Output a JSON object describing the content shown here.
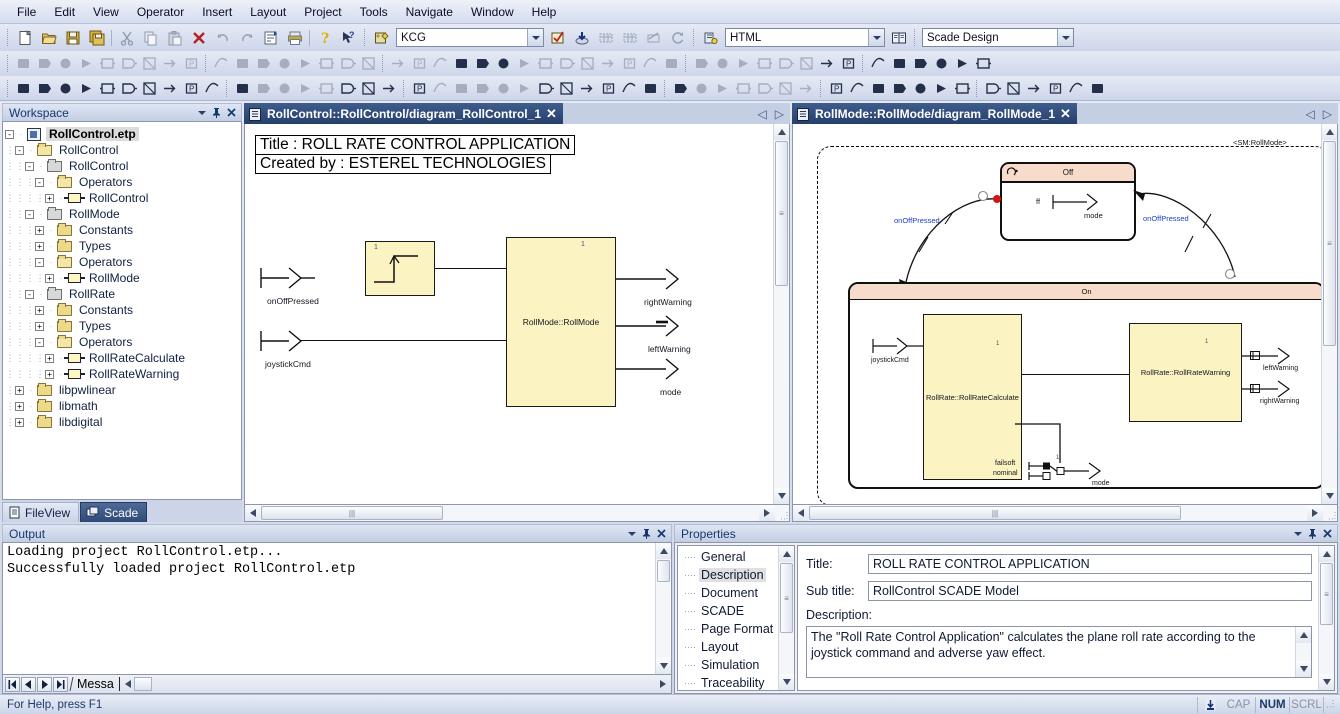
{
  "app": {
    "status_hint": "For Help, press F1",
    "status_indicators": [
      {
        "label": "CAP",
        "active": false
      },
      {
        "label": "NUM",
        "active": true
      },
      {
        "label": "SCRL",
        "active": false
      }
    ]
  },
  "menubar": {
    "items": [
      "File",
      "Edit",
      "View",
      "Operator",
      "Insert",
      "Layout",
      "Project",
      "Tools",
      "Navigate",
      "Window",
      "Help"
    ]
  },
  "toolbar1": {
    "icons": [
      "new-document-icon",
      "open-folder-icon",
      "save-icon",
      "save-all-icon",
      "cut-icon",
      "copy-icon",
      "paste-icon",
      "delete-icon",
      "undo-icon",
      "redo-icon",
      "properties-icon",
      "print-icon",
      "help-icon",
      "context-help-icon",
      "code-generation-icon"
    ],
    "kcg_combo": {
      "value": "KCG",
      "name": "code-generator-combo"
    },
    "icons2": [
      "check-model-icon",
      "import-icon",
      "table-insert-icon",
      "table-delete-icon",
      "table-export-icon",
      "refresh-icon"
    ],
    "report_icon": "report-generator-icon",
    "html_combo": {
      "value": "HTML",
      "name": "report-format-combo"
    },
    "book_icon": "documentation-icon",
    "profile_combo": {
      "value": "Scade Design",
      "name": "profile-combo"
    }
  },
  "toolbar2": {
    "row_a_count": 23,
    "row_b_count": 24,
    "note": "operator/diagram palette icons"
  },
  "workspace": {
    "title": "Workspace",
    "title_buttons": [
      "chevron-down-icon",
      "pin-icon",
      "close-icon"
    ],
    "tree": [
      {
        "depth": 0,
        "toggle": "-",
        "icon": "project",
        "label": "RollControl.etp",
        "selected": true
      },
      {
        "depth": 1,
        "toggle": "-",
        "icon": "folder-open",
        "label": "RollControl"
      },
      {
        "depth": 2,
        "toggle": "-",
        "icon": "folder-grey",
        "label": "RollControl"
      },
      {
        "depth": 3,
        "toggle": "-",
        "icon": "folder-open",
        "label": "Operators"
      },
      {
        "depth": 4,
        "toggle": "+",
        "icon": "operator",
        "label": "RollControl"
      },
      {
        "depth": 2,
        "toggle": "-",
        "icon": "folder-grey",
        "label": "RollMode"
      },
      {
        "depth": 3,
        "toggle": "+",
        "icon": "folder",
        "label": "Constants"
      },
      {
        "depth": 3,
        "toggle": "+",
        "icon": "folder",
        "label": "Types"
      },
      {
        "depth": 3,
        "toggle": "-",
        "icon": "folder-open",
        "label": "Operators"
      },
      {
        "depth": 4,
        "toggle": "+",
        "icon": "operator",
        "label": "RollMode"
      },
      {
        "depth": 2,
        "toggle": "-",
        "icon": "folder-grey",
        "label": "RollRate"
      },
      {
        "depth": 3,
        "toggle": "+",
        "icon": "folder",
        "label": "Constants"
      },
      {
        "depth": 3,
        "toggle": "+",
        "icon": "folder",
        "label": "Types"
      },
      {
        "depth": 3,
        "toggle": "-",
        "icon": "folder-open",
        "label": "Operators"
      },
      {
        "depth": 4,
        "toggle": "+",
        "icon": "operator",
        "label": "RollRateCalculate"
      },
      {
        "depth": 4,
        "toggle": "+",
        "icon": "operator",
        "label": "RollRateWarning"
      },
      {
        "depth": 1,
        "toggle": "+",
        "icon": "folder",
        "label": "libpwlinear"
      },
      {
        "depth": 1,
        "toggle": "+",
        "icon": "folder",
        "label": "libmath"
      },
      {
        "depth": 1,
        "toggle": "+",
        "icon": "folder",
        "label": "libdigital"
      }
    ],
    "tabs": [
      {
        "label": "FileView",
        "icon": "fileview-icon",
        "active": false
      },
      {
        "label": "Scade",
        "icon": "scade-icon",
        "active": true
      }
    ]
  },
  "editor_left": {
    "tab": {
      "label": "RollControl::RollControl/diagram_RollControl_1",
      "icon": "diagram-icon",
      "close": "✕"
    },
    "nav_prev": "◁",
    "nav_next": "▷",
    "annotation": {
      "line1": "Title : ROLL RATE CONTROL APPLICATION",
      "line2": "Created by : ESTEREL TECHNOLOGIES"
    },
    "diagram": {
      "inputs": [
        "onOffPressed",
        "joystickCmd"
      ],
      "outputs": [
        "rightWarning",
        "leftWarning",
        "mode"
      ],
      "blocks": [
        {
          "name": "edge-detect-block",
          "label": "",
          "index": "1"
        },
        {
          "name": "rollmode-block",
          "label": "RollMode::RollMode",
          "index": "1"
        }
      ]
    }
  },
  "editor_right": {
    "tab": {
      "label": "RollMode::RollMode/diagram_RollMode_1",
      "icon": "diagram-icon",
      "close": "✕"
    },
    "nav_prev": "◁",
    "nav_next": "▷",
    "diagram": {
      "sm_label": "<SM:RollMode>",
      "states": [
        {
          "name": "state-off",
          "label": "Off"
        },
        {
          "name": "state-on",
          "label": "On"
        }
      ],
      "transitions": [
        {
          "label": "onOffPressed"
        },
        {
          "label": "onOffPressed"
        }
      ],
      "off_state_contents": {
        "input": "ff",
        "output": "mode"
      },
      "on_state": {
        "inputs": [
          "joystickCmd"
        ],
        "blocks": [
          {
            "label": "RollRate::RollRateCalculate",
            "index": "1"
          },
          {
            "label": "RollRate::RollRateWarning",
            "index": "1"
          }
        ],
        "outputs": [
          "leftWarning",
          "rightWarning",
          "mode"
        ],
        "mux_inputs": [
          "failsoft",
          "nominal"
        ],
        "mux_index": "1"
      }
    }
  },
  "output_panel": {
    "title": "Output",
    "title_buttons": [
      "chevron-down-icon",
      "pin-icon",
      "close-icon"
    ],
    "lines": "Loading project RollControl.etp...\nSuccessfully loaded project RollControl.etp",
    "nav_buttons": [
      "first-icon",
      "prev-icon",
      "next-icon",
      "last-icon"
    ],
    "tab_label": "Messa"
  },
  "properties_panel": {
    "title": "Properties",
    "title_buttons": [
      "chevron-down-icon",
      "pin-icon",
      "close-icon"
    ],
    "tree": [
      {
        "label": "General",
        "selected": false
      },
      {
        "label": "Description",
        "selected": true
      },
      {
        "label": "Document",
        "selected": false
      },
      {
        "label": "SCADE",
        "selected": false
      },
      {
        "label": "Page Format",
        "selected": false
      },
      {
        "label": "Layout",
        "selected": false
      },
      {
        "label": "Simulation",
        "selected": false
      },
      {
        "label": "Traceability",
        "selected": false
      }
    ],
    "form": {
      "title_label": "Title:",
      "title_value": "ROLL RATE CONTROL APPLICATION",
      "subtitle_label": "Sub title:",
      "subtitle_value": "RollControl SCADE Model",
      "description_label": "Description:",
      "description_value": "The \"Roll Rate Control Application\" calculates the plane roll rate according to the joystick command and adverse yaw effect."
    }
  },
  "colors": {
    "tab_active": "#2e4a77",
    "block_fill": "#fbf3c2",
    "state_fill": "#f7dccb",
    "panel_bg": "#ccd5e8",
    "transition_label": "#1a3ec8"
  }
}
